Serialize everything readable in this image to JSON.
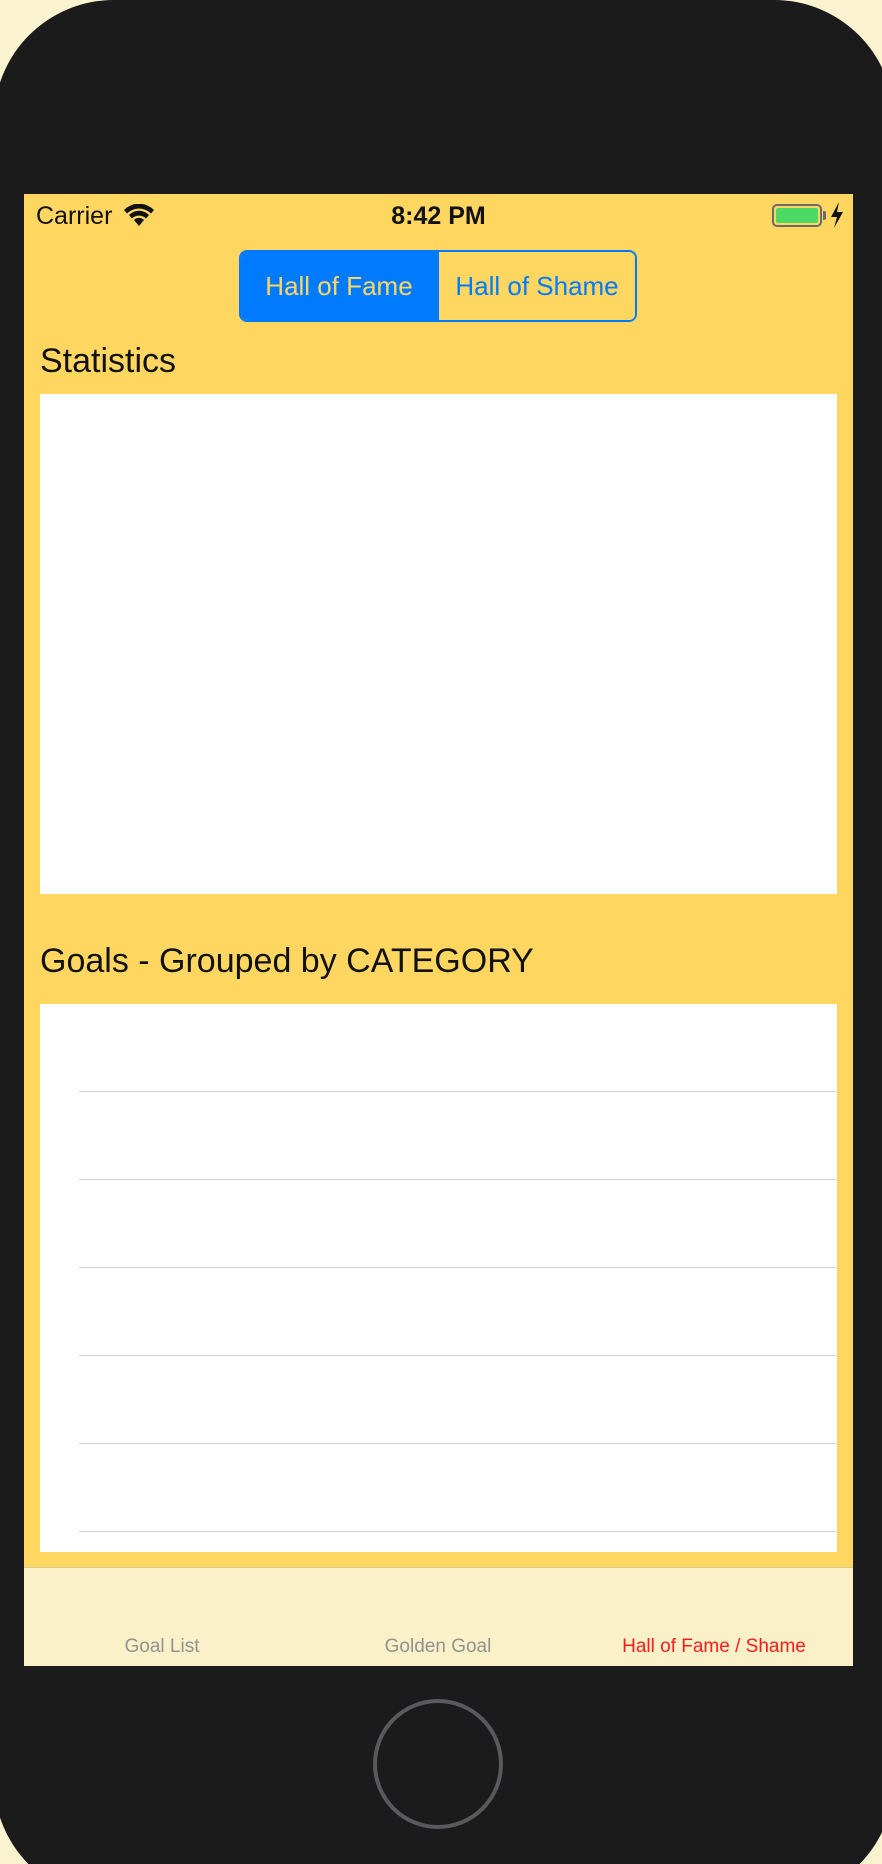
{
  "status_bar": {
    "carrier": "Carrier",
    "time": "8:42 PM",
    "wifi_icon": "wifi-icon",
    "battery_icon": "battery-icon",
    "charging_icon": "bolt-icon"
  },
  "segmented_control": {
    "segments": [
      "Hall of Fame",
      "Hall of Shame"
    ],
    "selected": "Hall of Fame"
  },
  "statistics": {
    "title": "Statistics"
  },
  "goals": {
    "title": "Goals - Grouped by CATEGORY",
    "rows": [
      "",
      "",
      "",
      "",
      "",
      ""
    ]
  },
  "tab_bar": {
    "items": [
      "Goal List",
      "Golden Goal",
      "Hall of Fame / Shame"
    ],
    "selected_index": 2
  },
  "colors": {
    "background": "#ffd760",
    "accent": "#007aff",
    "selected_tab": "#ff1a1a",
    "inactive_tab": "#929292"
  }
}
